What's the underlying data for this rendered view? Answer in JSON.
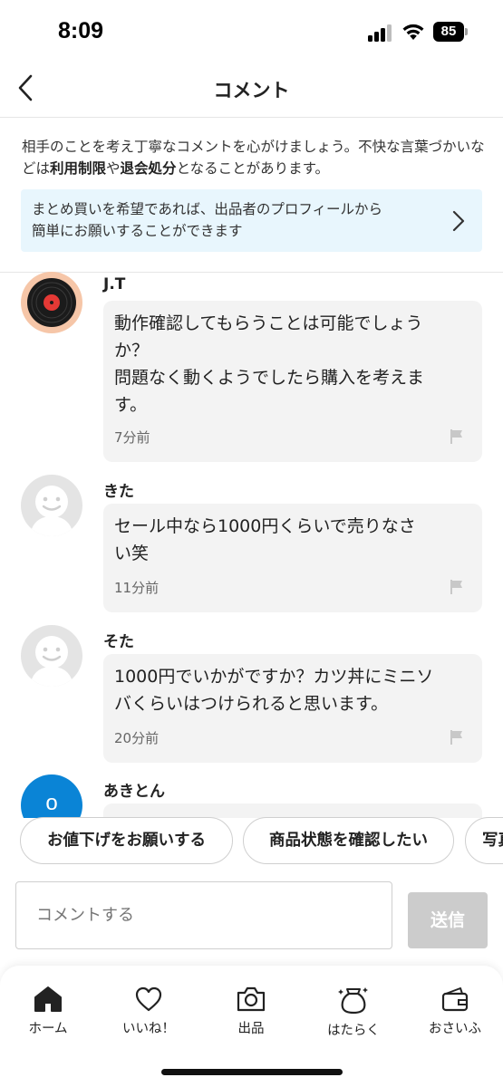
{
  "status_bar": {
    "time": "8:09",
    "battery": "85"
  },
  "header": {
    "title": "コメント"
  },
  "notice": {
    "part1": "相手のことを考え丁寧なコメントを心がけましょう。不快な言葉づかいなどは",
    "bold1": "利用制限",
    "part2": "や",
    "bold2": "退会処分",
    "part3": "となることがあります。"
  },
  "bundle_banner": {
    "line1": "まとめ買いを希望であれば、出品者のプロフィールから",
    "line2": "簡単にお願いすることができます"
  },
  "comments": [
    {
      "user": "J.T",
      "line1": "動作確認してもらうことは可能でしょう",
      "line2": "か？",
      "line3": "問題なく動くようでしたら購入を考えま",
      "line4": "す。",
      "time": "7分前"
    },
    {
      "user": "きた",
      "line1": "セール中なら1000円くらいで売りなさ",
      "line2": "い笑",
      "time": "11分前"
    },
    {
      "user": "そた",
      "line1": "1000円でいかがですか？カツ丼にミニソ",
      "line2": "バくらいはつけられると思います。",
      "time": "20分前"
    },
    {
      "user": "あきとん",
      "avatar_letter": "o"
    }
  ],
  "quick_replies": [
    "お値下げをお願いする",
    "商品状態を確認したい",
    "写真"
  ],
  "input": {
    "placeholder": "コメントする",
    "send_label": "送信"
  },
  "tabs": [
    {
      "label": "ホーム",
      "icon": "home-icon"
    },
    {
      "label": "いいね！",
      "icon": "heart-icon"
    },
    {
      "label": "出品",
      "icon": "camera-icon"
    },
    {
      "label": "はたらく",
      "icon": "money-bag-icon"
    },
    {
      "label": "おさいふ",
      "icon": "wallet-icon"
    }
  ],
  "colors": {
    "banner_bg": "#e8f6fd",
    "bubble_bg": "#f3f3f3",
    "avatar_blue": "#0a84d6",
    "send_disabled": "#cccccc"
  }
}
